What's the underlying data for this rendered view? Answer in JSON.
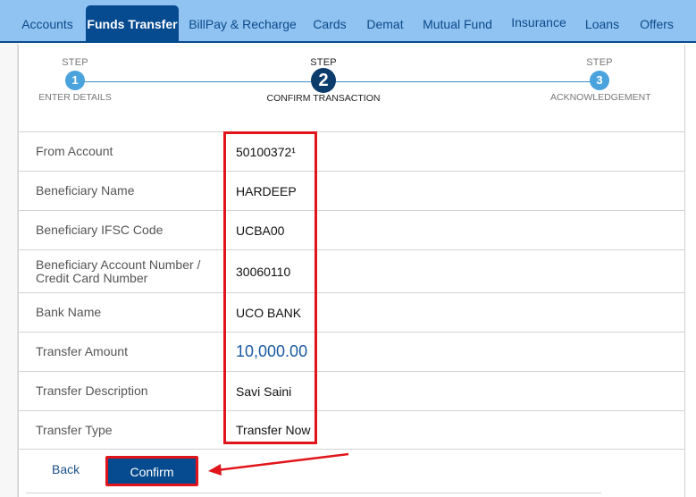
{
  "nav": {
    "items": [
      {
        "label": "Accounts",
        "active": false
      },
      {
        "label": "Funds Transfer",
        "active": true
      },
      {
        "label": "BillPay & Recharge",
        "active": false
      },
      {
        "label": "Cards",
        "active": false
      },
      {
        "label": "Demat",
        "active": false
      },
      {
        "label": "Mutual Fund",
        "active": false
      },
      {
        "label": "Insurance",
        "active": false
      },
      {
        "label": "Loans",
        "active": false
      },
      {
        "label": "Offers",
        "active": false
      }
    ]
  },
  "stepper": {
    "current_step": 2,
    "steps": [
      {
        "caption": "STEP",
        "number": "1",
        "label": "ENTER DETAILS"
      },
      {
        "caption": "STEP",
        "number": "2",
        "label": "CONFIRM TRANSACTION"
      },
      {
        "caption": "STEP",
        "number": "3",
        "label": "ACKNOWLEDGEMENT"
      }
    ]
  },
  "details": {
    "rows": [
      {
        "label": "From Account",
        "value": "50100372¹"
      },
      {
        "label": "Beneficiary Name",
        "value": "HARDEEP"
      },
      {
        "label": "Beneficiary IFSC Code",
        "value": "UCBA00"
      },
      {
        "label": "Beneficiary Account Number / Credit Card Number",
        "value": "30060110"
      },
      {
        "label": "Bank Name",
        "value": "UCO BANK"
      },
      {
        "label": "Transfer Amount",
        "value": "10,000.00"
      },
      {
        "label": "Transfer Description",
        "value": "Savi Saini"
      },
      {
        "label": "Transfer Type",
        "value": "Transfer Now"
      }
    ]
  },
  "actions": {
    "back_label": "Back",
    "confirm_label": "Confirm"
  },
  "annotations": {
    "highlight_color": "#e0151b",
    "arrow_icon": "red-arrow-pointing-left"
  },
  "colors": {
    "nav_bg": "#90c3f1",
    "brand_dark": "#064b8f",
    "step_active": "#0c3d6d",
    "step_inactive": "#4aa3dc",
    "amount_text": "#1a5aa0"
  }
}
